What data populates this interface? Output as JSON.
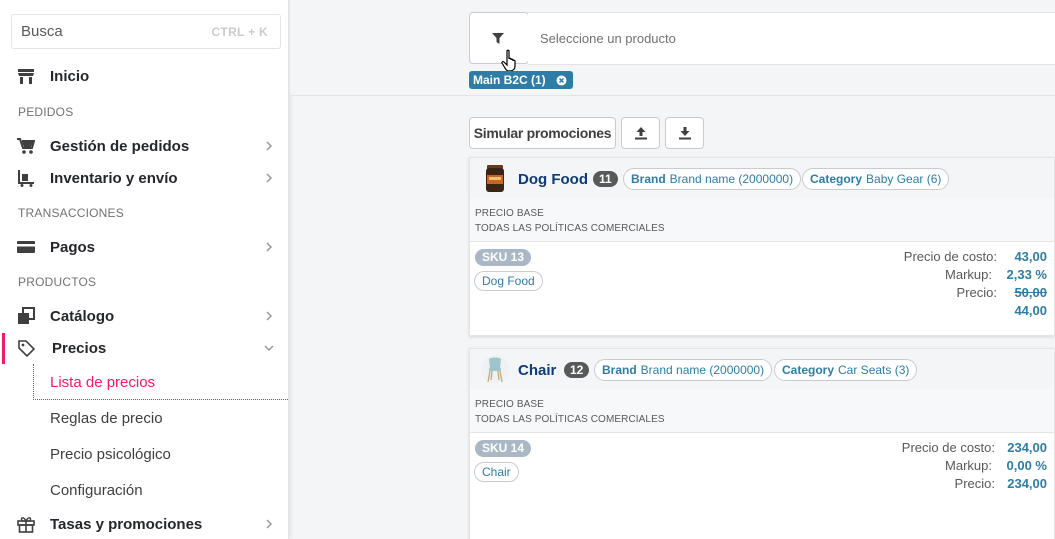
{
  "sidebar": {
    "search_placeholder": "Busca",
    "search_shortcut": "CTRL + K",
    "inicio": "Inicio",
    "section_pedidos": "PEDIDOS",
    "gestion_pedidos": "Gestión de pedidos",
    "inventario": "Inventario y envío",
    "section_transacciones": "TRANSACCIONES",
    "pagos": "Pagos",
    "section_productos": "PRODUCTOS",
    "catalogo": "Catálogo",
    "precios": "Precios",
    "precios_sub": [
      "Lista de precios",
      "Reglas de precio",
      "Precio psicológico",
      "Configuración"
    ],
    "tasas": "Tasas y promociones"
  },
  "filter": {
    "placeholder": "Seleccione un producto",
    "chip_label": "Main B2C (1)"
  },
  "toolbar": {
    "simular": "Simular promociones"
  },
  "cards": [
    {
      "name": "Dog Food",
      "count": "11",
      "brand_label": "Brand",
      "brand_value": "Brand name (2000000)",
      "category_label": "Category",
      "category_value": "Baby Gear (6)",
      "base_line1": "PRECIO BASE",
      "base_line2": "TODAS LAS POLÍTICAS COMERCIALES",
      "sku": "SKU 13",
      "sku_name": "Dog Food",
      "cost_label": "Precio de costo:",
      "cost_value": "43,00",
      "markup_label": "Markup:",
      "markup_value": "2,33 %",
      "price_label": "Precio:",
      "price_old": "50,00",
      "price_new": "44,00"
    },
    {
      "name": "Chair",
      "count": "12",
      "brand_label": "Brand",
      "brand_value": "Brand name (2000000)",
      "category_label": "Category",
      "category_value": "Car Seats (3)",
      "base_line1": "PRECIO BASE",
      "base_line2": "TODAS LAS POLÍTICAS COMERCIALES",
      "sku": "SKU 14",
      "sku_name": "Chair",
      "cost_label": "Precio de costo:",
      "cost_value": "234,00",
      "markup_label": "Markup:",
      "markup_value": "0,00 %",
      "price_label": "Precio:",
      "price_value": "234,00"
    }
  ],
  "colors": {
    "accent": "#f71963",
    "link": "#2d7da7",
    "title": "#0c3b77"
  }
}
